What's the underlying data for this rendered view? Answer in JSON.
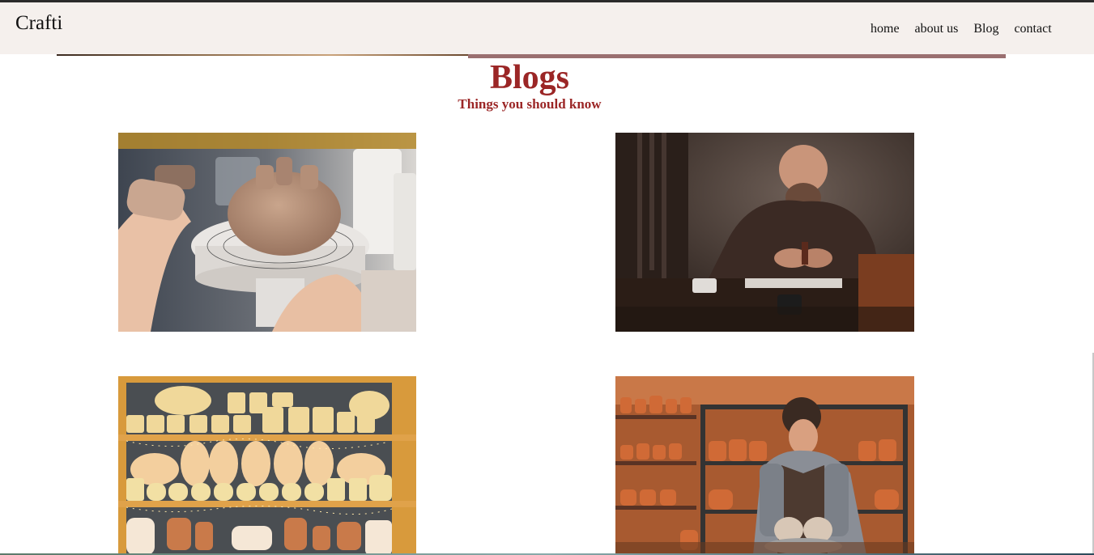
{
  "brand": {
    "name": "Crafti"
  },
  "nav": {
    "items": [
      {
        "label": "home"
      },
      {
        "label": "about us"
      },
      {
        "label": "Blog"
      },
      {
        "label": "contact"
      }
    ]
  },
  "hero": {
    "title": "Blogs",
    "subtitle": "Things you should know"
  },
  "colors": {
    "heading": "#9b2626",
    "accent_bar": "#9a6f70",
    "navbar_bg": "#f5f0ed"
  },
  "blog_cards": [
    {
      "image": "pottery-carving-photo"
    },
    {
      "image": "leather-craftsman-photo"
    },
    {
      "image": "ceramic-shelves-photo"
    },
    {
      "image": "potter-wheel-photo"
    }
  ]
}
